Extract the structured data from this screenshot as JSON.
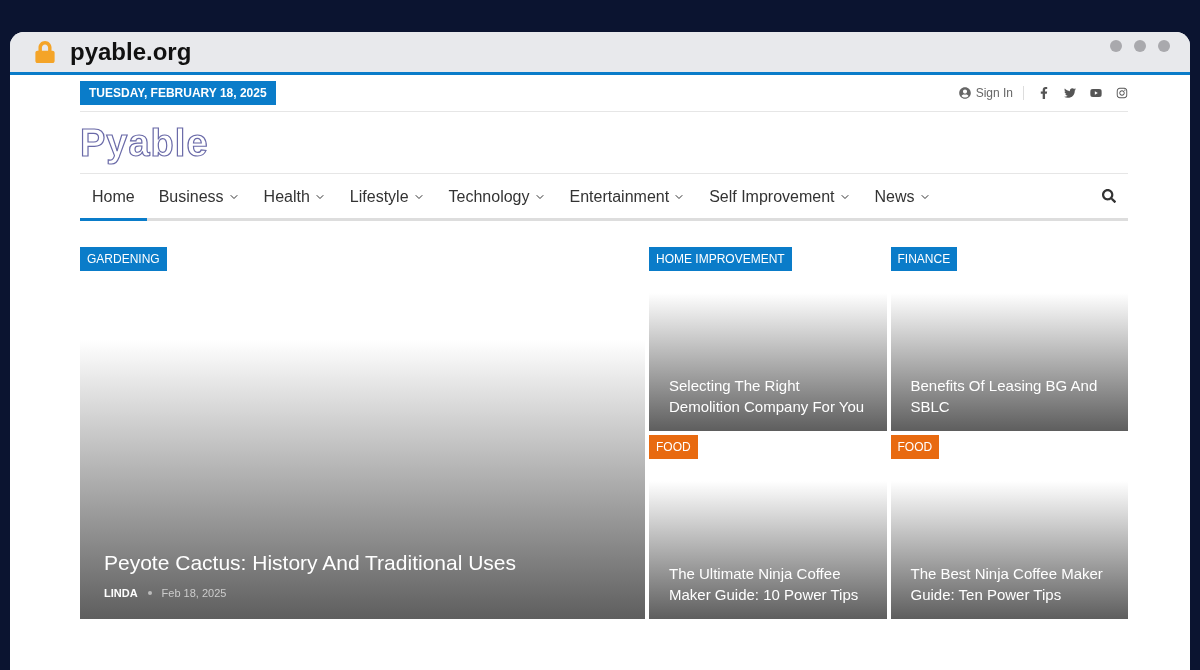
{
  "browser": {
    "url": "pyable.org"
  },
  "topbar": {
    "date": "TUESDAY, FEBRUARY 18, 2025",
    "sign_in": "Sign In"
  },
  "logo": "Pyable",
  "nav": [
    {
      "label": "Home",
      "selected": true,
      "dropdown": false
    },
    {
      "label": "Business",
      "selected": false,
      "dropdown": true
    },
    {
      "label": "Health",
      "selected": false,
      "dropdown": true
    },
    {
      "label": "Lifestyle",
      "selected": false,
      "dropdown": true
    },
    {
      "label": "Technology",
      "selected": false,
      "dropdown": true
    },
    {
      "label": "Entertainment",
      "selected": false,
      "dropdown": true
    },
    {
      "label": "Self Improvement",
      "selected": false,
      "dropdown": true
    },
    {
      "label": "News",
      "selected": false,
      "dropdown": true
    }
  ],
  "featured": {
    "category": "GARDENING",
    "color": "#0a7cc9",
    "title": "Peyote Cactus: History And Traditional Uses",
    "author": "LINDA",
    "date": "Feb 18, 2025"
  },
  "grid": [
    {
      "category": "HOME IMPROVEMENT",
      "color": "#0a7cc9",
      "title": "Selecting The Right Demolition Company For You"
    },
    {
      "category": "FINANCE",
      "color": "#0a7cc9",
      "title": "Benefits Of Leasing BG And SBLC"
    },
    {
      "category": "FOOD",
      "color": "#e86a10",
      "title": "The Ultimate Ninja Coffee Maker Guide: 10 Power Tips"
    },
    {
      "category": "FOOD",
      "color": "#e86a10",
      "title": "The Best Ninja Coffee Maker Guide: Ten Power Tips"
    }
  ]
}
